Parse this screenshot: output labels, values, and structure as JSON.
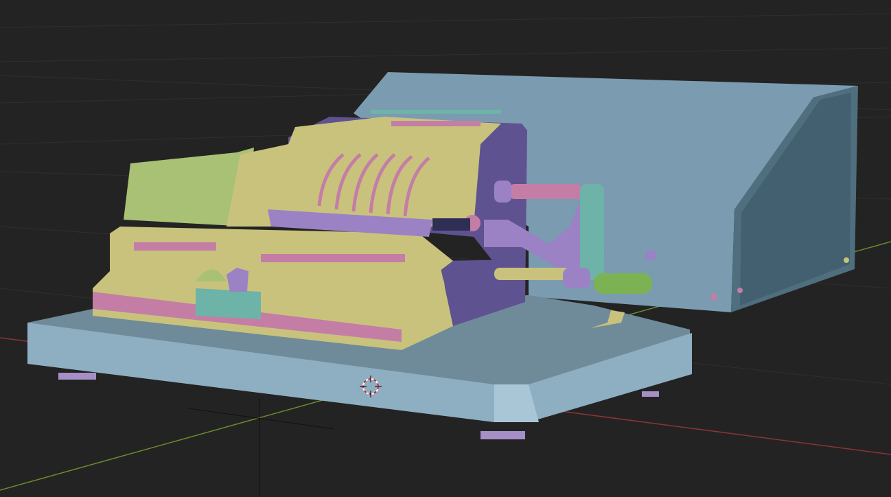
{
  "viewport": {
    "background": "#232323",
    "grid_color": "#2f2f2f",
    "x_axis_color": "#8c3434",
    "y_axis_color": "#6b8a2c",
    "icons": [
      "3d-cursor-icon"
    ]
  },
  "model": {
    "colors": {
      "base_top": "#6f8b9a",
      "base_front": "#8eaec2",
      "box_face": "#7b9bb0",
      "box_side": "#4f6e7e",
      "body_yellow": "#c9c27c",
      "body_green": "#a9c174",
      "body_purple": "#5f5290",
      "strip_pink": "#c47ea6",
      "crank_purple": "#9b82c4",
      "crank_teal": "#6db3a8",
      "handle_green": "#7db253",
      "feet_lilac": "#a68fc6"
    }
  }
}
